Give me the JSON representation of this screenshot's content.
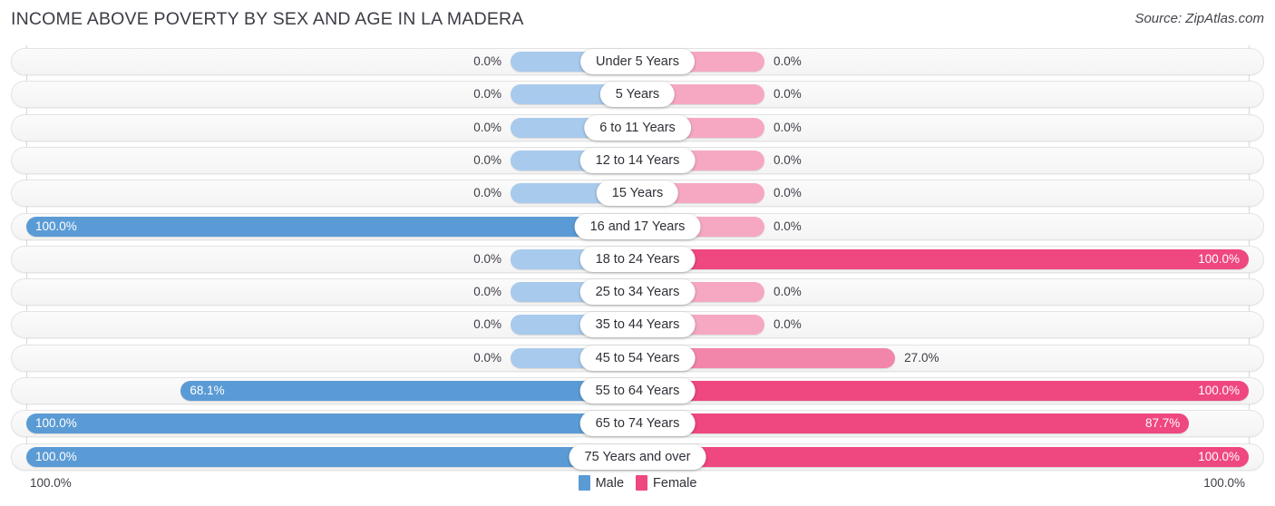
{
  "header": {
    "title": "INCOME ABOVE POVERTY BY SEX AND AGE IN LA MADERA",
    "source": "Source: ZipAtlas.com"
  },
  "legend": {
    "male_label": "Male",
    "female_label": "Female",
    "male_color": "#5b9bd5",
    "female_color": "#ef477f"
  },
  "axis": {
    "left_max": "100.0%",
    "right_max": "100.0%"
  },
  "chart_data": {
    "type": "bar",
    "orientation": "horizontal-diverging",
    "title": "INCOME ABOVE POVERTY BY SEX AND AGE IN LA MADERA",
    "xlabel": "",
    "ylabel": "",
    "xlim": [
      0,
      100
    ],
    "grid": true,
    "legend_position": "bottom-center",
    "categories": [
      "Under 5 Years",
      "5 Years",
      "6 to 11 Years",
      "12 to 14 Years",
      "15 Years",
      "16 and 17 Years",
      "18 to 24 Years",
      "25 to 34 Years",
      "35 to 44 Years",
      "45 to 54 Years",
      "55 to 64 Years",
      "65 to 74 Years",
      "75 Years and over"
    ],
    "series": [
      {
        "name": "Male",
        "values": [
          0.0,
          0.0,
          0.0,
          0.0,
          0.0,
          100.0,
          0.0,
          0.0,
          0.0,
          0.0,
          68.1,
          100.0,
          100.0
        ],
        "labels": [
          "0.0%",
          "0.0%",
          "0.0%",
          "0.0%",
          "0.0%",
          "100.0%",
          "0.0%",
          "0.0%",
          "0.0%",
          "0.0%",
          "68.1%",
          "100.0%",
          "100.0%"
        ]
      },
      {
        "name": "Female",
        "values": [
          0.0,
          0.0,
          0.0,
          0.0,
          0.0,
          0.0,
          100.0,
          0.0,
          0.0,
          27.0,
          100.0,
          87.7,
          100.0
        ],
        "labels": [
          "0.0%",
          "0.0%",
          "0.0%",
          "0.0%",
          "0.0%",
          "0.0%",
          "100.0%",
          "0.0%",
          "0.0%",
          "27.0%",
          "100.0%",
          "87.7%",
          "100.0%"
        ]
      }
    ]
  }
}
